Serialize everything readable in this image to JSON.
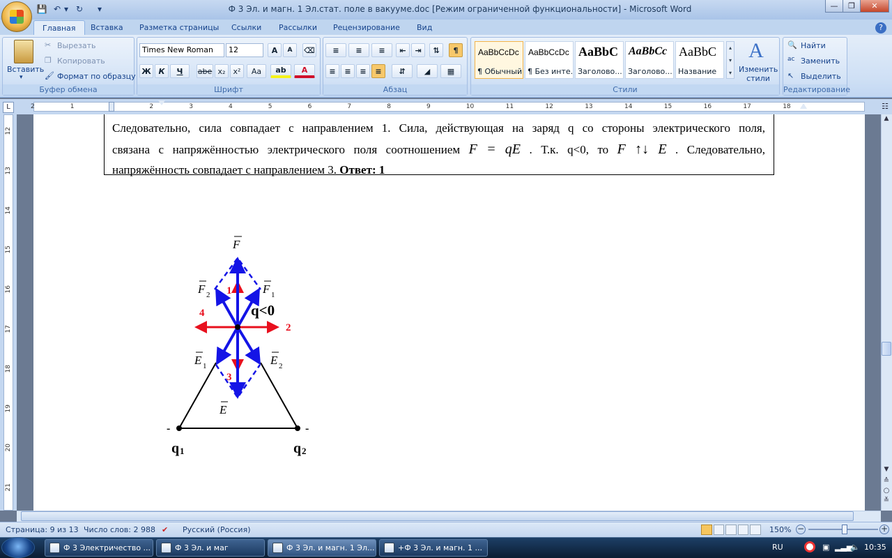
{
  "window": {
    "title": "Ф 3 Эл. и магн. 1 Эл.стат. поле в вакууме.doc [Режим ограниченной функциональности] - Microsoft Word",
    "undo_icon": "undo-icon",
    "redo_icon": "redo-icon"
  },
  "tabs": [
    "Главная",
    "Вставка",
    "Разметка страницы",
    "Ссылки",
    "Рассылки",
    "Рецензирование",
    "Вид"
  ],
  "clipboard": {
    "paste": "Вставить",
    "cut": "Вырезать",
    "copy": "Копировать",
    "format_painter": "Формат по образцу",
    "label": "Буфер обмена"
  },
  "font": {
    "family": "Times New Roman",
    "size": "12",
    "bold": "Ж",
    "italic": "К",
    "underline": "Ч",
    "strike": "abe",
    "subscript": "x₂",
    "superscript": "x²",
    "case": "Aa",
    "label": "Шрифт"
  },
  "paragraph": {
    "label": "Абзац"
  },
  "styles": {
    "items": [
      {
        "sample": "AaBbCcDc",
        "name": "¶ Обычный"
      },
      {
        "sample": "AaBbCcDc",
        "name": "¶ Без инте..."
      },
      {
        "sample": "AaBbC",
        "name": "Заголово..."
      },
      {
        "sample": "AaBbCc",
        "name": "Заголово..."
      },
      {
        "sample": "AaBbC",
        "name": "Название"
      }
    ],
    "change": "Изменить стили",
    "label": "Стили"
  },
  "editing": {
    "find": "Найти",
    "replace": "Заменить",
    "select": "Выделить",
    "label": "Редактирование"
  },
  "ruler": {
    "h_numbers": [
      "2",
      "1",
      "1",
      "2",
      "3",
      "4",
      "5",
      "6",
      "7",
      "8",
      "9",
      "10",
      "11",
      "12",
      "13",
      "14",
      "15",
      "16",
      "17",
      "18"
    ],
    "v_numbers": [
      "12",
      "13",
      "14",
      "15",
      "16",
      "17",
      "18",
      "19",
      "20",
      "21"
    ]
  },
  "document": {
    "line1": "Следовательно, сила совпадает с направлением 1. Сила, действующая на заряд q со стороны электрического поля,",
    "line2_a": "связана с напряжённостью электрического поля соотношением",
    "line2_formula": "F = qE",
    "line2_b": ". Т.к. q<0, то",
    "line2_formula2": "F ↑↓ E",
    "line2_c": ". Следовательно,",
    "line3": "напряжённость совпадает с направлением 3.",
    "answer": "Ответ: 1"
  },
  "diagram": {
    "F": "F",
    "F1": "F",
    "F1_sub": "1",
    "F2": "F",
    "F2_sub": "2",
    "E": "E",
    "E1": "E",
    "E1_sub": "1",
    "E2": "E",
    "E2_sub": "2",
    "charge": "q<0",
    "dir1": "1",
    "dir2": "2",
    "dir3": "3",
    "dir4": "4",
    "q1": "q",
    "q1_sub": "1",
    "q2": "q",
    "q2_sub": "2",
    "minus": "-",
    "colors": {
      "blue": "#1414e6",
      "red": "#e8101e"
    }
  },
  "status": {
    "page": "Страница: 9 из 13",
    "words": "Число слов: 2 988",
    "language": "Русский (Россия)",
    "zoom": "150%"
  },
  "taskbar": {
    "items": [
      "Ф 3 Электричество ...",
      "Ф 3 Эл. и маг",
      "Ф 3 Эл. и магн. 1 Эл...",
      "+Ф 3 Эл. и магн. 1 ..."
    ],
    "lang": "RU",
    "time": "10:35"
  }
}
